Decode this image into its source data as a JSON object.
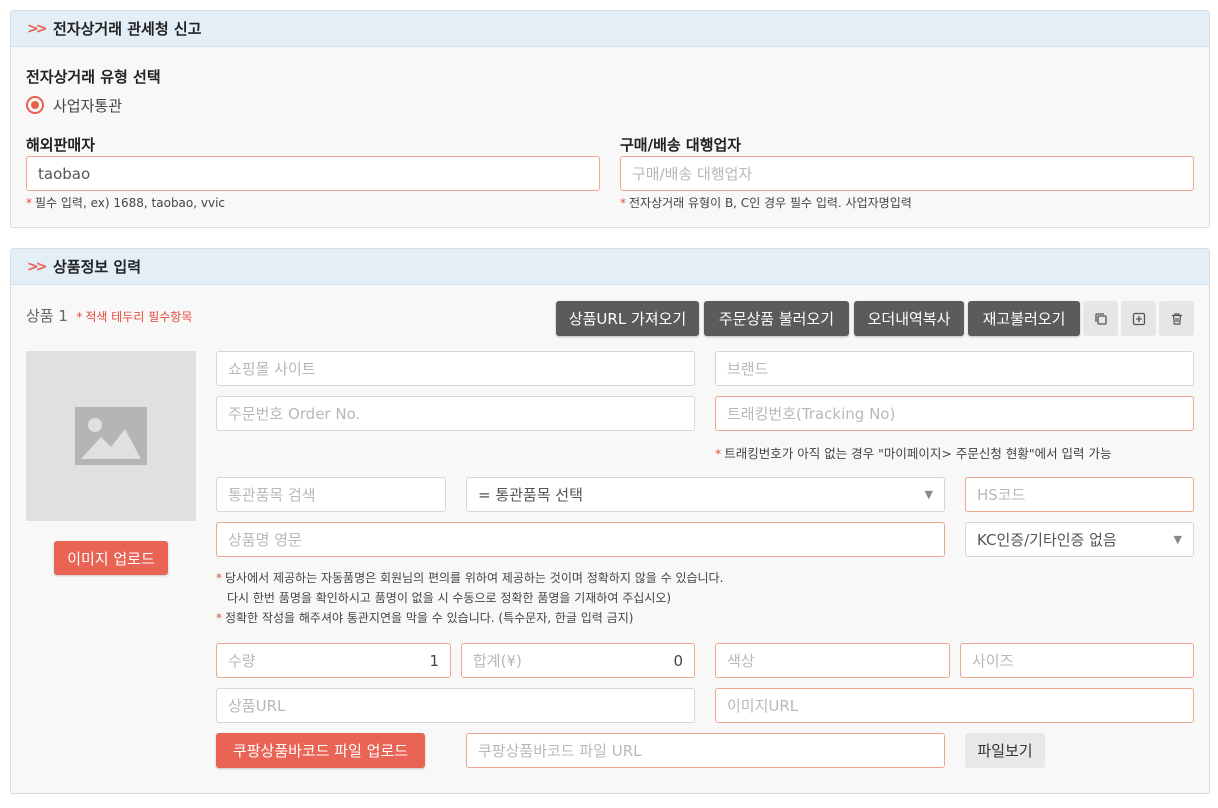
{
  "section1": {
    "title": "전자상거래 관세청 신고",
    "type_label": "전자상거래 유형 선택",
    "radio_option": "사업자통관",
    "seller_label": "해외판매자",
    "seller_value": "taobao",
    "seller_note": "필수 입력, ex) 1688, taobao, vvic",
    "agent_label": "구매/배송 대행업자",
    "agent_placeholder": "구매/배송 대행업자",
    "agent_note": "전자상거래 유형이 B, C인 경우 필수 입력. 사업자명입력"
  },
  "section2": {
    "title": "상품정보 입력",
    "item_label": "상품 1",
    "item_required_note": "적색 테두리 필수항목",
    "buttons": {
      "fetch_url": "상품URL 가져오기",
      "load_order": "주문상품 불러오기",
      "copy_order": "오더내역복사",
      "load_stock": "재고불러오기"
    },
    "upload_image": "이미지 업로드",
    "fields": {
      "mall_site": "쇼핑몰 사이트",
      "brand": "브랜드",
      "order_no": "주문번호 Order No.",
      "tracking_no": "트래킹번호(Tracking No)",
      "customs_search": "통관품목 검색",
      "customs_select": "= 통관품목 선택",
      "hs_code": "HS코드",
      "product_name_en": "상품명 영문",
      "kc_cert": "KC인증/기타인증 없음",
      "quantity": "수량",
      "quantity_value": "1",
      "total": "합계(¥)",
      "total_value": "0",
      "color": "색상",
      "size": "사이즈",
      "product_url": "상품URL",
      "image_url": "이미지URL",
      "coupang_url": "쿠팡상품바코드 파일 URL"
    },
    "tracking_note": "트래킹번호가 아직 없는 경우 \"마이페이지> 주문신청 현황\"에서 입력 가능",
    "notes": [
      "당사에서 제공하는 자동품명은 회원님의 편의를 위하여 제공하는 것이며 정확하지 않을 수 있습니다.",
      "다시 한번 품명을 확인하시고 품명이 없을 시 수동으로 정확한 품명을 기재하여 주십시오)",
      "정확한 작성을 해주셔야 통관지연을 막을 수 있습니다. (특수문자, 한글 입력 금지)"
    ],
    "coupang_upload": "쿠팡상품바코드 파일 업로드",
    "view_file": "파일보기"
  },
  "colors": {
    "accent": "#e8604c",
    "header_bg": "#e3eef7",
    "dark_button": "#5b5b5b",
    "required_border": "#f0a58e"
  },
  "icons": [
    "chevron-double-right-icon",
    "radio-selected-icon",
    "copy-icon",
    "add-icon",
    "trash-icon",
    "image-placeholder-icon",
    "dropdown-caret-icon"
  ]
}
